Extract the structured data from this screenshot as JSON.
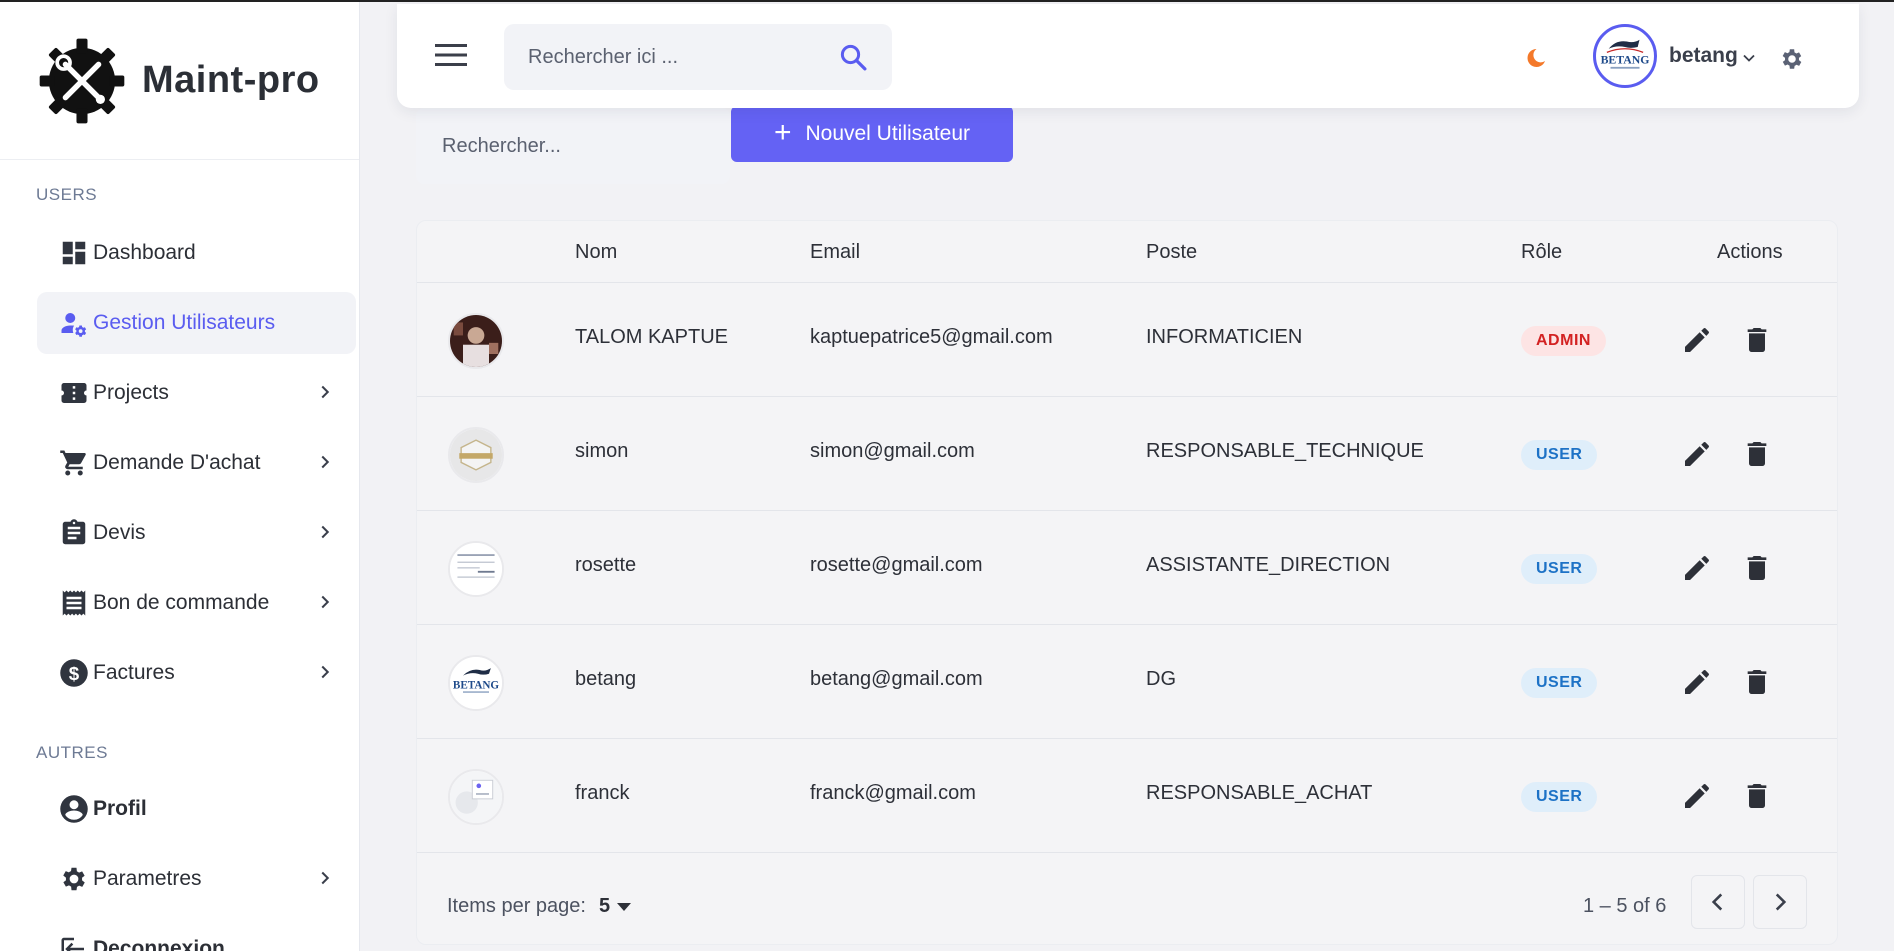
{
  "brand": {
    "name": "Maint-pro"
  },
  "sidebar": {
    "sections": [
      {
        "label": "USERS"
      },
      {
        "label": "AUTRES"
      }
    ],
    "items": [
      {
        "label": "Dashboard",
        "icon": "dashboard-icon",
        "active": false,
        "chevron": false
      },
      {
        "label": "Gestion Utilisateurs",
        "icon": "manage-users-icon",
        "active": true,
        "chevron": false
      },
      {
        "label": "Projects",
        "icon": "ticket-icon",
        "active": false,
        "chevron": true
      },
      {
        "label": "Demande D'achat",
        "icon": "cart-icon",
        "active": false,
        "chevron": true
      },
      {
        "label": "Devis",
        "icon": "clipboard-icon",
        "active": false,
        "chevron": true
      },
      {
        "label": "Bon de commande",
        "icon": "receipt-icon",
        "active": false,
        "chevron": true
      },
      {
        "label": "Factures",
        "icon": "dollar-icon",
        "active": false,
        "chevron": true
      },
      {
        "label": "Profil",
        "icon": "account-circle-icon",
        "active": false,
        "chevron": false
      },
      {
        "label": "Parametres",
        "icon": "gear-icon",
        "active": false,
        "chevron": true
      },
      {
        "label": "Deconnexion",
        "icon": "logout-icon",
        "active": false,
        "chevron": false
      }
    ]
  },
  "topbar": {
    "search_placeholder": "Rechercher ici ...",
    "user_name": "betang"
  },
  "toolbar": {
    "filter_placeholder": "Rechercher...",
    "new_user_label": "Nouvel Utilisateur"
  },
  "table": {
    "columns": [
      "Nom",
      "Email",
      "Poste",
      "Rôle",
      "Actions"
    ],
    "rows": [
      {
        "name": "TALOM KAPTUE",
        "email": "kaptuepatrice5@gmail.com",
        "poste": "INFORMATICIEN",
        "role": "ADMIN",
        "avatar": "photo"
      },
      {
        "name": "simon",
        "email": "simon@gmail.com",
        "poste": "RESPONSABLE_TECHNIQUE",
        "role": "USER",
        "avatar": "maint-pro-logo"
      },
      {
        "name": "rosette",
        "email": "rosette@gmail.com",
        "poste": "ASSISTANTE_DIRECTION",
        "role": "USER",
        "avatar": "document"
      },
      {
        "name": "betang",
        "email": "betang@gmail.com",
        "poste": "DG",
        "role": "USER",
        "avatar": "betang-logo"
      },
      {
        "name": "franck",
        "email": "franck@gmail.com",
        "poste": "RESPONSABLE_ACHAT",
        "role": "USER",
        "avatar": "screenshot"
      }
    ]
  },
  "paginator": {
    "items_per_page_label": "Items per page:",
    "items_per_page": "5",
    "range_label": "1 – 5 of 6"
  },
  "colors": {
    "accent": "#6462f4",
    "admin_badge_text": "#d32222",
    "user_badge_text": "#1d72c6",
    "moon": "#f4792a"
  }
}
